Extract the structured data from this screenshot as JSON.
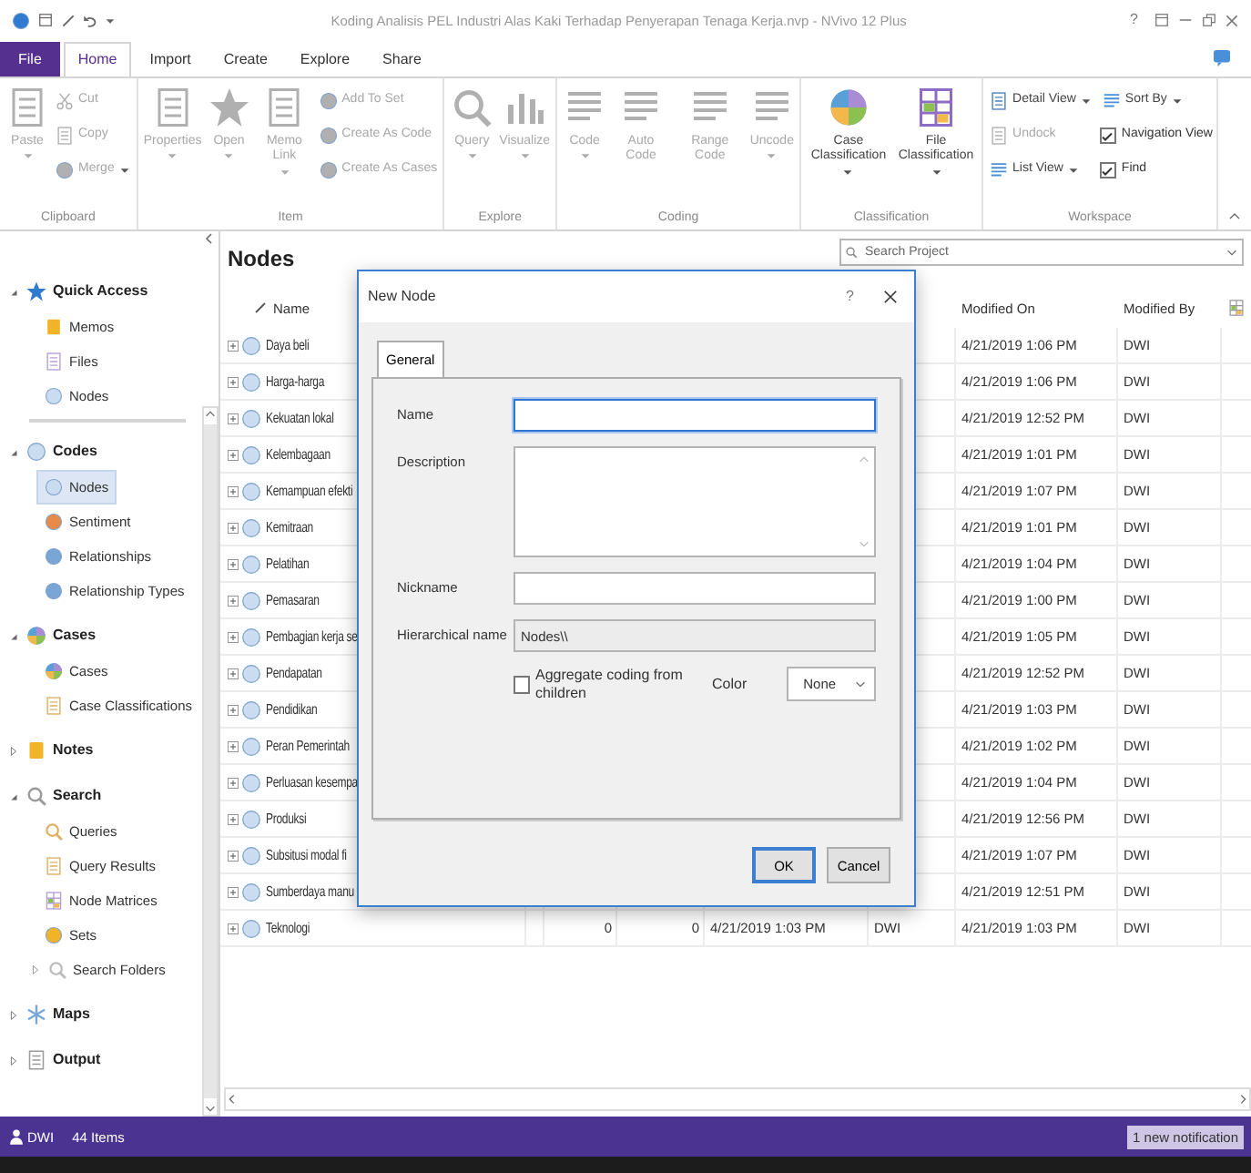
{
  "window": {
    "title": "Koding Analisis PEL Industri Alas Kaki Terhadap Penyerapan Tenaga Kerja.nvp - NVivo 12 Plus",
    "help": "?"
  },
  "ribbon": {
    "tabs": [
      {
        "label": "File",
        "kind": "file",
        "selected": false
      },
      {
        "label": "Home",
        "kind": "tab",
        "selected": true
      },
      {
        "label": "Import",
        "kind": "tab",
        "selected": false
      },
      {
        "label": "Create",
        "kind": "tab",
        "selected": false
      },
      {
        "label": "Explore",
        "kind": "tab",
        "selected": false
      },
      {
        "label": "Share",
        "kind": "tab",
        "selected": false
      }
    ],
    "groups": [
      {
        "label": "Clipboard",
        "items": [
          {
            "label": "Paste",
            "kind": "large",
            "disabled": true,
            "dropdown": true
          },
          {
            "label": "Cut",
            "kind": "small",
            "disabled": true,
            "dropdown": false
          },
          {
            "label": "Copy",
            "kind": "small",
            "disabled": true,
            "dropdown": false
          },
          {
            "label": "Merge",
            "kind": "small",
            "disabled": true,
            "dropdown": true
          }
        ]
      },
      {
        "label": "Item",
        "items": [
          {
            "label": "Properties",
            "kind": "large",
            "disabled": true,
            "dropdown": true
          },
          {
            "label": "Open",
            "kind": "large",
            "disabled": true,
            "dropdown": true
          },
          {
            "label": "Memo Link",
            "kind": "large",
            "disabled": true,
            "dropdown": true
          },
          {
            "label": "Add To Set",
            "kind": "small",
            "disabled": true,
            "dropdown": false
          },
          {
            "label": "Create As Code",
            "kind": "small",
            "disabled": true,
            "dropdown": false
          },
          {
            "label": "Create As Cases",
            "kind": "small",
            "disabled": true,
            "dropdown": false
          }
        ]
      },
      {
        "label": "Explore",
        "items": [
          {
            "label": "Query",
            "kind": "large",
            "disabled": true,
            "dropdown": true
          },
          {
            "label": "Visualize",
            "kind": "large",
            "disabled": true,
            "dropdown": true
          }
        ]
      },
      {
        "label": "Coding",
        "items": [
          {
            "label": "Code",
            "kind": "large",
            "disabled": true,
            "dropdown": true
          },
          {
            "label": "Auto Code",
            "kind": "large",
            "disabled": true,
            "dropdown": false
          },
          {
            "label": "Range Code",
            "kind": "large",
            "disabled": true,
            "dropdown": false
          },
          {
            "label": "Uncode",
            "kind": "large",
            "disabled": true,
            "dropdown": true
          }
        ]
      },
      {
        "label": "Classification",
        "items": [
          {
            "label": "Case Classification",
            "kind": "large",
            "disabled": false,
            "dropdown": true
          },
          {
            "label": "File Classification",
            "kind": "large",
            "disabled": false,
            "dropdown": true
          }
        ]
      },
      {
        "label": "Workspace",
        "items": [
          {
            "label": "Detail View",
            "kind": "small",
            "disabled": false,
            "dropdown": true
          },
          {
            "label": "Undock",
            "kind": "small",
            "disabled": true,
            "dropdown": false
          },
          {
            "label": "List View",
            "kind": "small",
            "disabled": false,
            "dropdown": true
          },
          {
            "label": "Sort By",
            "kind": "small",
            "disabled": false,
            "dropdown": true
          },
          {
            "label": "Navigation View",
            "kind": "check",
            "disabled": false,
            "checked": true
          },
          {
            "label": "Find",
            "kind": "check",
            "disabled": false,
            "checked": true
          }
        ]
      }
    ]
  },
  "navigation": {
    "sections": [
      {
        "label": "Quick Access",
        "expanded": true,
        "children": [
          {
            "label": "Memos",
            "kind": "leaf",
            "selected": false
          },
          {
            "label": "Files",
            "kind": "leaf",
            "selected": false
          },
          {
            "label": "Nodes",
            "kind": "leaf",
            "selected": false
          }
        ]
      },
      {
        "label": "Codes",
        "expanded": true,
        "children": [
          {
            "label": "Nodes",
            "kind": "leaf",
            "selected": true
          },
          {
            "label": "Sentiment",
            "kind": "leaf",
            "selected": false
          },
          {
            "label": "Relationships",
            "kind": "leaf",
            "selected": false
          },
          {
            "label": "Relationship Types",
            "kind": "leaf",
            "selected": false
          }
        ]
      },
      {
        "label": "Cases",
        "expanded": true,
        "children": [
          {
            "label": "Cases",
            "kind": "leaf",
            "selected": false
          },
          {
            "label": "Case Classifications",
            "kind": "leaf",
            "selected": false
          }
        ]
      },
      {
        "label": "Notes",
        "expanded": false
      },
      {
        "label": "Search",
        "expanded": true,
        "children": [
          {
            "label": "Queries",
            "kind": "leaf",
            "selected": false
          },
          {
            "label": "Query Results",
            "kind": "leaf",
            "selected": false
          },
          {
            "label": "Node Matrices",
            "kind": "leaf",
            "selected": false
          },
          {
            "label": "Sets",
            "kind": "leaf",
            "selected": false
          },
          {
            "label": "Search Folders",
            "kind": "folder",
            "selected": false
          }
        ]
      },
      {
        "label": "Maps",
        "expanded": false
      },
      {
        "label": "Output",
        "expanded": false
      }
    ]
  },
  "node_list": {
    "title": "Nodes",
    "search": {
      "placeholder": "Search Project"
    },
    "columns": [
      {
        "label": "Name"
      },
      {
        "label": "Modified On"
      },
      {
        "label": "Modified By"
      }
    ],
    "rows": [
      {
        "name": "Daya beli",
        "modified_on": "4/21/2019 1:06 PM",
        "modified_by": "DWI"
      },
      {
        "name": "Harga-harga",
        "modified_on": "4/21/2019 1:06 PM",
        "modified_by": "DWI"
      },
      {
        "name": "Kekuatan lokal",
        "modified_on": "4/21/2019 12:52 PM",
        "modified_by": "DWI"
      },
      {
        "name": "Kelembagaan",
        "modified_on": "4/21/2019 1:01 PM",
        "modified_by": "DWI"
      },
      {
        "name": "Kemampuan efekti",
        "modified_on": "4/21/2019 1:07 PM",
        "modified_by": "DWI"
      },
      {
        "name": "Kemitraan",
        "modified_on": "4/21/2019 1:01 PM",
        "modified_by": "DWI"
      },
      {
        "name": "Pelatihan",
        "modified_on": "4/21/2019 1:04 PM",
        "modified_by": "DWI"
      },
      {
        "name": "Pemasaran",
        "modified_on": "4/21/2019 1:00 PM",
        "modified_by": "DWI"
      },
      {
        "name": "Pembagian kerja se",
        "modified_on": "4/21/2019 1:05 PM",
        "modified_by": "DWI"
      },
      {
        "name": "Pendapatan",
        "modified_on": "4/21/2019 12:52 PM",
        "modified_by": "DWI"
      },
      {
        "name": "Pendidikan",
        "modified_on": "4/21/2019 1:03 PM",
        "modified_by": "DWI"
      },
      {
        "name": "Peran Pemerintah",
        "modified_on": "4/21/2019 1:02 PM",
        "modified_by": "DWI"
      },
      {
        "name": "Perluasan kesempa",
        "modified_on": "4/21/2019 1:04 PM",
        "modified_by": "DWI"
      },
      {
        "name": "Produksi",
        "modified_on": "4/21/2019 12:56 PM",
        "modified_by": "DWI"
      },
      {
        "name": "Subsitusi modal fi",
        "modified_on": "4/21/2019 1:07 PM",
        "modified_by": "DWI"
      },
      {
        "name": "Sumberdaya manu",
        "modified_on": "4/21/2019 12:51 PM",
        "modified_by": "DWI"
      },
      {
        "name": "Teknologi",
        "column_3": "0",
        "column_4": "0",
        "column_5": "4/21/2019 1:03 PM",
        "column_6": "DWI",
        "modified_on": "4/21/2019 1:03 PM",
        "modified_by": "DWI"
      }
    ]
  },
  "dialog": {
    "title": "New Node",
    "help": "?",
    "tabs": [
      {
        "label": "General",
        "selected": true
      }
    ],
    "fields": [
      {
        "label": "Name",
        "kind": "text",
        "focused": true
      },
      {
        "label": "Description",
        "kind": "textarea",
        "focused": false
      },
      {
        "label": "Nickname",
        "kind": "text",
        "focused": false
      },
      {
        "label": "Hierarchical name",
        "kind": "readonly",
        "focused": false,
        "value": "Nodes\\\\"
      }
    ],
    "aggregate": {
      "label": "Aggregate coding from children",
      "checked": false
    },
    "color": {
      "label": "Color",
      "value": "None"
    },
    "buttons": [
      {
        "label": "OK",
        "default": true
      },
      {
        "label": "Cancel",
        "default": false
      }
    ]
  },
  "status_bar": {
    "user": "DWI",
    "items": "44 Items",
    "notification": "1 new notification"
  }
}
